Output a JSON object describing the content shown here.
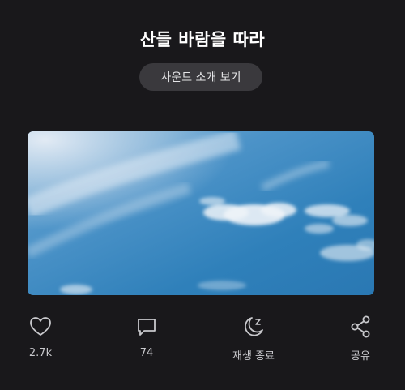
{
  "header": {
    "title": "산들 바람을 따라",
    "intro_button_label": "사운드 소개 보기"
  },
  "cover": {
    "description_icon": "sky-clouds-image"
  },
  "actions": [
    {
      "name": "like",
      "icon": "heart-icon",
      "label": "2.7k"
    },
    {
      "name": "comment",
      "icon": "comment-icon",
      "label": "74"
    },
    {
      "name": "sleep-timer",
      "icon": "moon-zz-icon",
      "label": "재생 종료"
    },
    {
      "name": "share",
      "icon": "share-icon",
      "label": "공유"
    }
  ],
  "colors": {
    "background": "#19181b",
    "button_bg": "#3a393d",
    "icon": "#c8c8cc"
  }
}
